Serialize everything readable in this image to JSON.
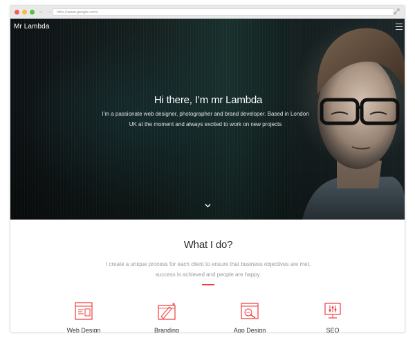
{
  "browser": {
    "url": "http://www.google.com/"
  },
  "site": {
    "brand": "Mr Lambda",
    "icons": {
      "menu": "hamburger-menu-icon",
      "scroll": "chevron-down-icon"
    }
  },
  "hero": {
    "title": "Hi there, I’m mr Lambda",
    "subtitle_line1": "I’m a passionate web designer, photographer and brand developer. Based in London",
    "subtitle_line2": "UK at the moment and always excited to work on new projects"
  },
  "about": {
    "title": "What I do?",
    "text_line1": "I create a unique process for each client to ensure that business objectives are met,",
    "text_line2": "success is achieved and people are happy.",
    "accent_color": "#ee3b3b"
  },
  "services": [
    {
      "label": "Web Design",
      "icon": "web-design-icon"
    },
    {
      "label": "Branding",
      "icon": "branding-icon"
    },
    {
      "label": "App Design",
      "icon": "app-design-icon"
    },
    {
      "label": "SEO",
      "icon": "seo-icon"
    }
  ]
}
